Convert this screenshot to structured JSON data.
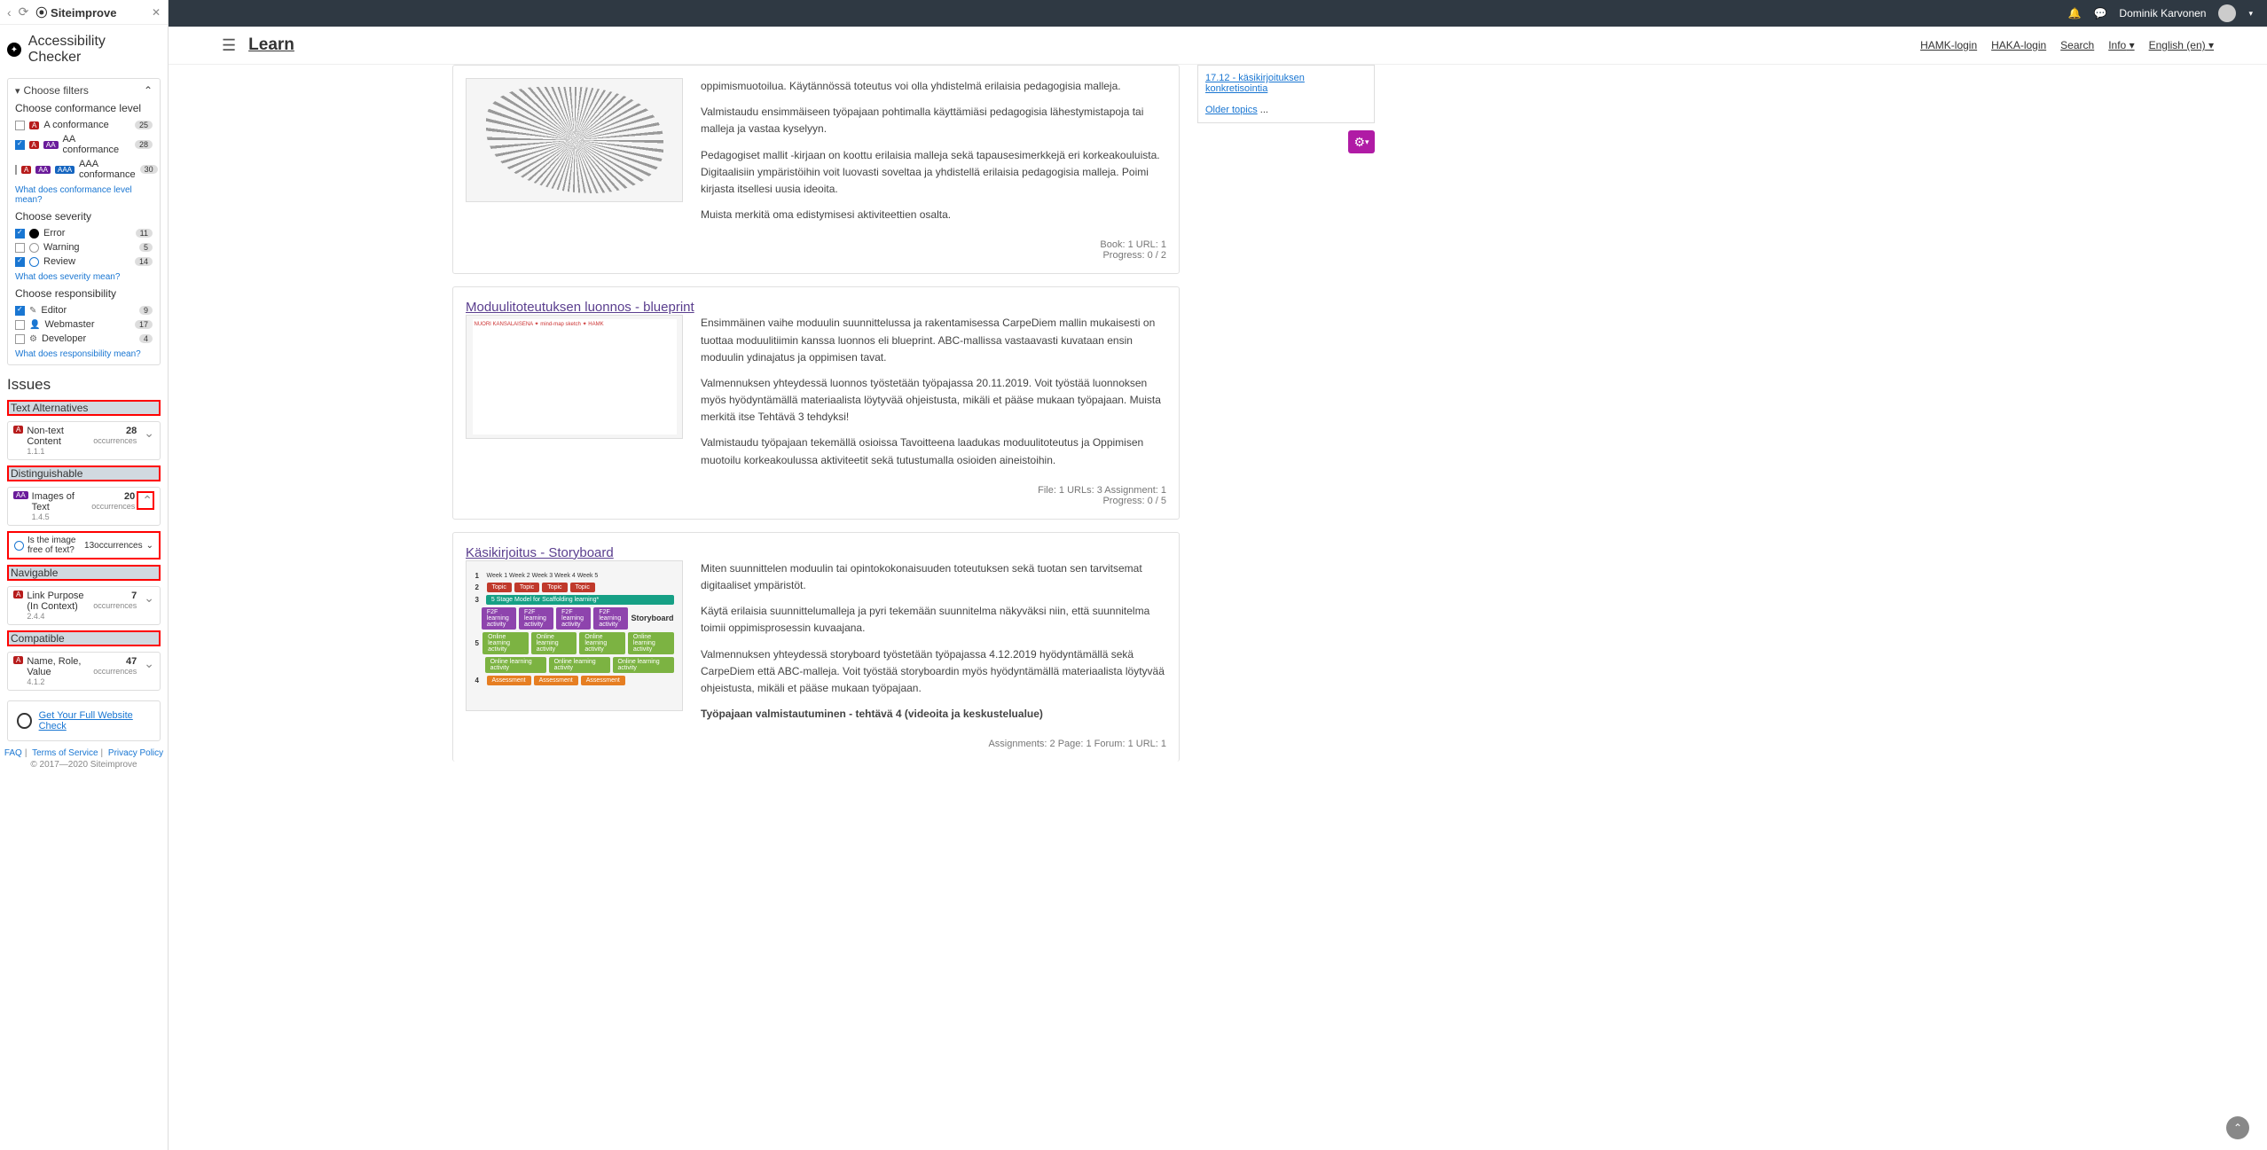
{
  "sidebar": {
    "logo": "⦿ Siteimprove",
    "title": "Accessibility Checker",
    "choose_filters": "Choose filters",
    "conformance": {
      "title": "Choose conformance level",
      "items": [
        {
          "label": "A conformance",
          "count": "25"
        },
        {
          "label": "AA conformance",
          "count": "28"
        },
        {
          "label": "AAA conformance",
          "count": "30"
        }
      ],
      "link": "What does conformance level mean?"
    },
    "severity": {
      "title": "Choose severity",
      "items": [
        {
          "label": "Error",
          "count": "11"
        },
        {
          "label": "Warning",
          "count": "5"
        },
        {
          "label": "Review",
          "count": "14"
        }
      ],
      "link": "What does severity mean?"
    },
    "responsibility": {
      "title": "Choose responsibility",
      "items": [
        {
          "label": "Editor",
          "count": "9"
        },
        {
          "label": "Webmaster",
          "count": "17"
        },
        {
          "label": "Developer",
          "count": "4"
        }
      ],
      "link": "What does responsibility mean?"
    },
    "issues_header": "Issues",
    "issues": {
      "text_alternatives": {
        "cat": "Text Alternatives",
        "name": "Non-text Content",
        "ref": "1.1.1",
        "count": "28",
        "occ": "occurrences"
      },
      "distinguishable": {
        "cat": "Distinguishable",
        "name": "Images of Text",
        "ref": "1.4.5",
        "count": "20",
        "occ": "occurrences",
        "sub_q": "Is the image free of text?",
        "sub_count": "13",
        "sub_occ": "occurrences"
      },
      "navigable": {
        "cat": "Navigable",
        "name": "Link Purpose (In Context)",
        "ref": "2.4.4",
        "count": "7",
        "occ": "occurrences"
      },
      "compatible": {
        "cat": "Compatible",
        "name": "Name, Role, Value",
        "ref": "4.1.2",
        "count": "47",
        "occ": "occurrences"
      }
    },
    "cta": "Get Your Full Website Check",
    "footer": {
      "faq": "FAQ",
      "tos": "Terms of Service",
      "privacy": "Privacy Policy",
      "copy": "© 2017—2020 Siteimprove"
    }
  },
  "topbar": {
    "user": "Dominik Karvonen"
  },
  "navbar": {
    "brand": "Learn",
    "links": {
      "hamk": "HAMK-login",
      "haka": "HAKA-login",
      "search": "Search",
      "info": "Info",
      "lang": "English (en)"
    }
  },
  "content": {
    "card1": {
      "p1": "oppimismuotoilua. Käytännössä toteutus voi olla yhdistelmä erilaisia pedagogisia malleja.",
      "p2": "Valmistaudu ensimmäiseen työpajaan pohtimalla käyttämiäsi pedagogisia lähestymistapoja tai malleja ja vastaa kyselyyn.",
      "p3": "Pedagogiset mallit -kirjaan on koottu erilaisia malleja sekä tapausesimerkkejä eri korkeakouluista. Digitaalisiin ympäristöihin voit luovasti soveltaa ja yhdistellä erilaisia pedagogisia malleja. Poimi kirjasta itsellesi uusia ideoita.",
      "p4": "Muista merkitä oma edistymisesi aktiviteettien osalta.",
      "f1": "Book: 1  URL: 1",
      "f2": "Progress: 0 / 2"
    },
    "card2": {
      "title": "Moduulitoteutuksen luonnos - blueprint",
      "p1": "Ensimmäinen vaihe moduulin suunnittelussa ja rakentamisessa CarpeDiem mallin mukaisesti on tuottaa moduulitiimin kanssa luonnos eli blueprint. ABC-mallissa vastaavasti kuvataan ensin moduulin ydinajatus ja oppimisen tavat.",
      "p2": "Valmennuksen yhteydessä luonnos työstetään työpajassa 20.11.2019. Voit työstää luonnoksen myös hyödyntämällä materiaalista löytyvää ohjeistusta, mikäli et pääse mukaan työpajaan. Muista merkitä itse Tehtävä 3 tehdyksi!",
      "p3": "Valmistaudu työpajaan tekemällä osioissa Tavoitteena laadukas moduulitoteutus ja Oppimisen muotoilu korkeakoulussa aktiviteetit sekä tutustumalla osioiden aineistoihin.",
      "f1": "File: 1  URLs: 3  Assignment: 1",
      "f2": "Progress: 0 / 5"
    },
    "card3": {
      "title": "Käsikirjoitus - Storyboard",
      "p1": "Miten suunnittelen moduulin tai opintokokonaisuuden toteutuksen sekä tuotan sen tarvitsemat digitaaliset ympäristöt.",
      "p2": "Käytä erilaisia suunnittelumalleja ja pyri tekemään suunnitelma näkyväksi niin, että suunnitelma toimii oppimisprosessin kuvaajana.",
      "p3": "Valmennuksen yhteydessä storyboard työstetään työpajassa 4.12.2019 hyödyntämällä sekä CarpeDiem että ABC-malleja. Voit työstää storyboardin myös hyödyntämällä materiaalista löytyvää ohjeistusta, mikäli et pääse mukaan työpajaan.",
      "p4": "Työpajaan valmistautuminen - tehtävä 4 (videoita ja keskustelualue)",
      "f1": "Assignments: 2  Page: 1  Forum: 1  URL: 1"
    },
    "storyboard": {
      "weeks": "Week 1   Week 2   Week 3   Week 4   Week 5",
      "topic": "Topic",
      "stage": "5 Stage Model for Scaffolding learning*",
      "f2f": "F2F learning activity",
      "online": "Online learning activity",
      "assess": "Assessment",
      "label": "Storyboard"
    }
  },
  "right": {
    "link1": "17.12 - käsikirjoituksen konkretisointia",
    "older": "Older topics",
    "dots": "..."
  }
}
